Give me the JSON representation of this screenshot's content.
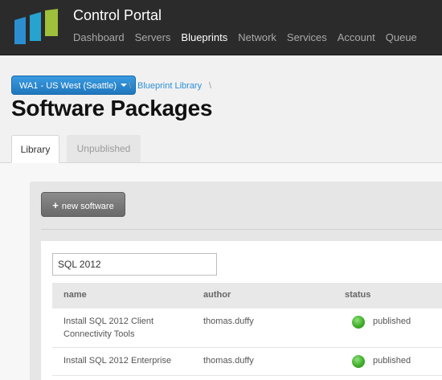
{
  "header": {
    "app_title": "Control Portal",
    "nav": [
      {
        "label": "Dashboard",
        "active": false
      },
      {
        "label": "Servers",
        "active": false
      },
      {
        "label": "Blueprints",
        "active": true
      },
      {
        "label": "Network",
        "active": false
      },
      {
        "label": "Services",
        "active": false
      },
      {
        "label": "Account",
        "active": false
      },
      {
        "label": "Queue",
        "active": false
      }
    ],
    "logo_colors": [
      "#2b8ed1",
      "#27a3cf",
      "#9ec03a"
    ]
  },
  "breadcrumb": {
    "datacenter": "WA1 - US West (Seattle)",
    "separator": "\\",
    "link": "Blueprint Library"
  },
  "page_title": "Software Packages",
  "tabs": [
    {
      "label": "Library",
      "active": true
    },
    {
      "label": "Unpublished",
      "active": false
    }
  ],
  "toolbar": {
    "new_label": "new software"
  },
  "search": {
    "value": "SQL 2012"
  },
  "table": {
    "columns": [
      "name",
      "author",
      "status"
    ],
    "rows": [
      {
        "name": "Install SQL 2012 Client Connectivity Tools",
        "author": "thomas.duffy",
        "status": "published"
      },
      {
        "name": "Install SQL 2012 Enterprise",
        "author": "thomas.duffy",
        "status": "published"
      }
    ]
  },
  "colors": {
    "accent": "#2d8fd6",
    "status_published": "#3fae2a"
  }
}
